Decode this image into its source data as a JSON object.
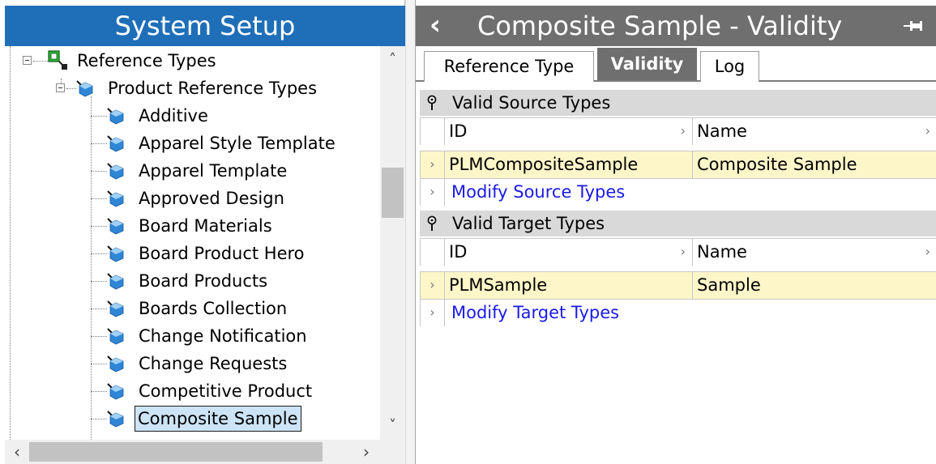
{
  "left_panel": {
    "title": "System Setup",
    "tree": {
      "root_label": "Reference Types",
      "group_label": "Product Reference Types",
      "items": [
        "Additive",
        "Apparel Style Template",
        "Apparel Template",
        "Approved Design",
        "Board Materials",
        "Board Product Hero",
        "Board Products",
        "Boards Collection",
        "Change Notification",
        "Change Requests",
        "Competitive Product",
        "Composite Sample"
      ],
      "selected_item": "Composite Sample"
    },
    "scrollbar": {
      "up_icon": "chevron-up-icon",
      "down_icon": "chevron-down-icon",
      "left_icon": "chevron-left-icon",
      "right_icon": "chevron-right-icon"
    }
  },
  "right_panel": {
    "title": "Composite Sample - Validity",
    "back_icon": "chevron-left-icon",
    "pin_icon": "pin-icon",
    "tabs": [
      {
        "label": "Reference Type",
        "active": false
      },
      {
        "label": "Validity",
        "active": true
      },
      {
        "label": "Log",
        "active": false
      }
    ],
    "sections": [
      {
        "title": "Valid Source Types",
        "columns": [
          "ID",
          "Name"
        ],
        "rows": [
          {
            "id": "PLMCompositeSample",
            "name": "Composite Sample"
          }
        ],
        "action_label": "Modify Source Types"
      },
      {
        "title": "Valid Target Types",
        "columns": [
          "ID",
          "Name"
        ],
        "rows": [
          {
            "id": "PLMSample",
            "name": "Sample"
          }
        ],
        "action_label": "Modify Target Types"
      }
    ]
  },
  "colors": {
    "left_header_bg": "#1f6fb8",
    "right_header_bg": "#6f6f6f",
    "section_header_bg": "#d9d9d9",
    "data_row_bg": "#fdf6c8",
    "link_color": "#1a1ae6",
    "selection_bg": "#cde4f7"
  }
}
